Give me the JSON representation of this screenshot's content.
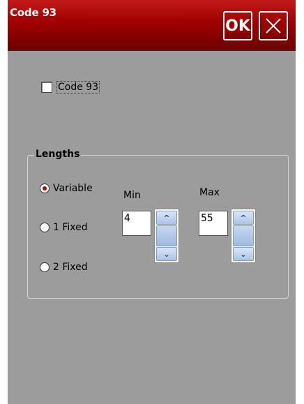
{
  "titlebar": {
    "title": "Code 93",
    "ok_label": "OK",
    "close_icon": "close-icon",
    "colors": {
      "bar": "#a00000",
      "text": "#ffffff"
    }
  },
  "enable": {
    "label": "Code 93",
    "checked": false
  },
  "lengths": {
    "group_label": "Lengths",
    "options": [
      {
        "label": "Variable",
        "selected": true
      },
      {
        "label": "1 Fixed",
        "selected": false
      },
      {
        "label": "2 Fixed",
        "selected": false
      }
    ],
    "min": {
      "label": "Min",
      "value": "4"
    },
    "max": {
      "label": "Max",
      "value": "55"
    }
  },
  "spinner_icons": {
    "up": "^",
    "down": "⌄"
  },
  "colors": {
    "window": "#9c9c9c",
    "radio_selected": "#c00000"
  }
}
